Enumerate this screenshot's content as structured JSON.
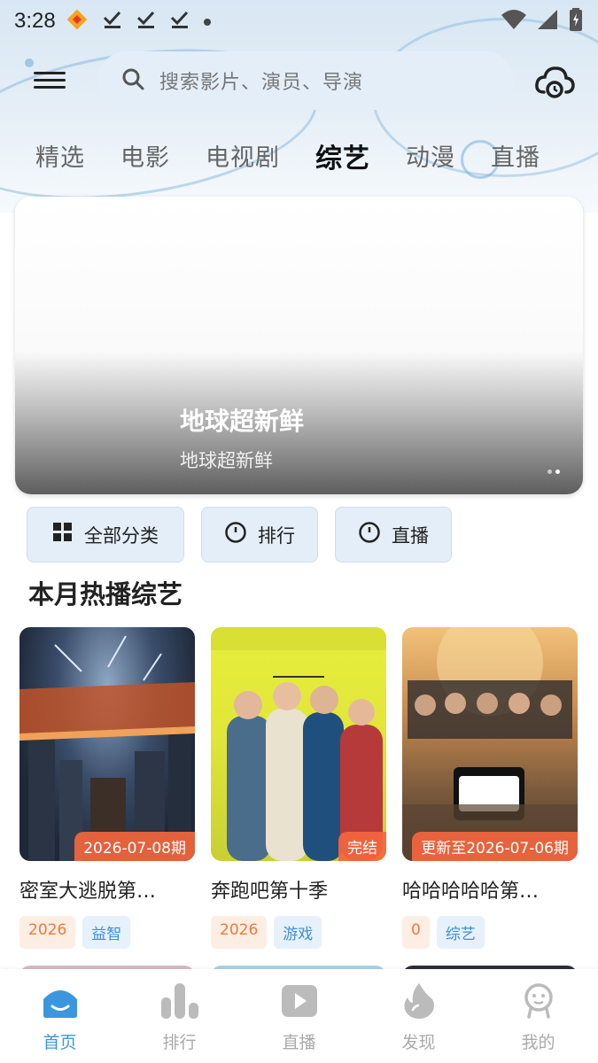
{
  "status_bar": {
    "time": "3:28"
  },
  "search": {
    "placeholder": "搜索影片、演员、导演"
  },
  "tabs": [
    {
      "label": "精选"
    },
    {
      "label": "电影"
    },
    {
      "label": "电视剧"
    },
    {
      "label": "综艺",
      "active": true
    },
    {
      "label": "动漫"
    },
    {
      "label": "直播"
    }
  ],
  "banner": {
    "title": "地球超新鲜",
    "subtitle": "地球超新鲜"
  },
  "quick_links": [
    {
      "label": "全部分类",
      "icon": "grid-icon"
    },
    {
      "label": "排行",
      "icon": "circle-icon"
    },
    {
      "label": "直播",
      "icon": "circle-icon"
    }
  ],
  "section": {
    "title": "本月热播综艺"
  },
  "cards": [
    {
      "title": "密室大逃脱第…",
      "badge": "2026-07-08期",
      "year": "2026",
      "genre": "益智"
    },
    {
      "title": "奔跑吧第十季",
      "badge": "完结",
      "year": "2026",
      "genre": "游戏"
    },
    {
      "title": "哈哈哈哈哈第…",
      "badge": "更新至2026-07-06期",
      "year": "0",
      "genre": "综艺"
    }
  ],
  "bottom_nav": [
    {
      "label": "首页",
      "icon": "home-icon",
      "active": true
    },
    {
      "label": "排行",
      "icon": "ranking-icon"
    },
    {
      "label": "直播",
      "icon": "play-icon"
    },
    {
      "label": "发现",
      "icon": "flame-icon"
    },
    {
      "label": "我的",
      "icon": "profile-icon"
    }
  ],
  "colors": {
    "accent": "#3b97dd",
    "badge": "#f3663e",
    "year_tag": "#f07a3a",
    "genre_tag": "#3f8fd4"
  }
}
